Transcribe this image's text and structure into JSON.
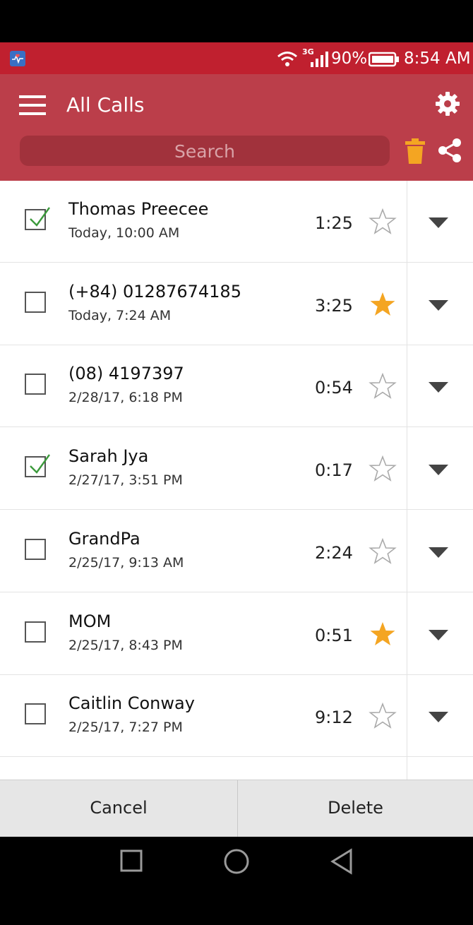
{
  "status_bar": {
    "network": "3G",
    "battery": "90%",
    "time": "8:54 AM"
  },
  "app_bar": {
    "title": "All Calls",
    "search_placeholder": "Search"
  },
  "colors": {
    "status_bar": "#c0202f",
    "app_bar": "#bb3e4a",
    "search_bg": "#a1323c",
    "star_active": "#f4a522",
    "trash": "#f4a522"
  },
  "calls": [
    {
      "name": "Thomas Preecee",
      "time": "Today, 10:00 AM",
      "duration": "1:25",
      "checked": true,
      "starred": false
    },
    {
      "name": "(+84) 01287674185",
      "time": "Today, 7:24 AM",
      "duration": "3:25",
      "checked": false,
      "starred": true
    },
    {
      "name": "(08) 4197397",
      "time": "2/28/17, 6:18 PM",
      "duration": "0:54",
      "checked": false,
      "starred": false
    },
    {
      "name": "Sarah Jya",
      "time": "2/27/17, 3:51 PM",
      "duration": "0:17",
      "checked": true,
      "starred": false
    },
    {
      "name": "GrandPa",
      "time": "2/25/17, 9:13 AM",
      "duration": "2:24",
      "checked": false,
      "starred": false
    },
    {
      "name": "MOM",
      "time": "2/25/17, 8:43 PM",
      "duration": "0:51",
      "checked": false,
      "starred": true
    },
    {
      "name": "Caitlin Conway",
      "time": "2/25/17, 7:27 PM",
      "duration": "9:12",
      "checked": false,
      "starred": false
    }
  ],
  "actions": {
    "cancel": "Cancel",
    "delete": "Delete"
  },
  "icons": [
    "heart-monitor-icon",
    "wifi-icon",
    "signal-icon",
    "battery-icon",
    "menu-icon",
    "gear-icon",
    "trash-icon",
    "share-icon",
    "checkbox-icon",
    "star-icon",
    "chevron-down-icon",
    "recents-icon",
    "home-icon",
    "back-icon"
  ]
}
